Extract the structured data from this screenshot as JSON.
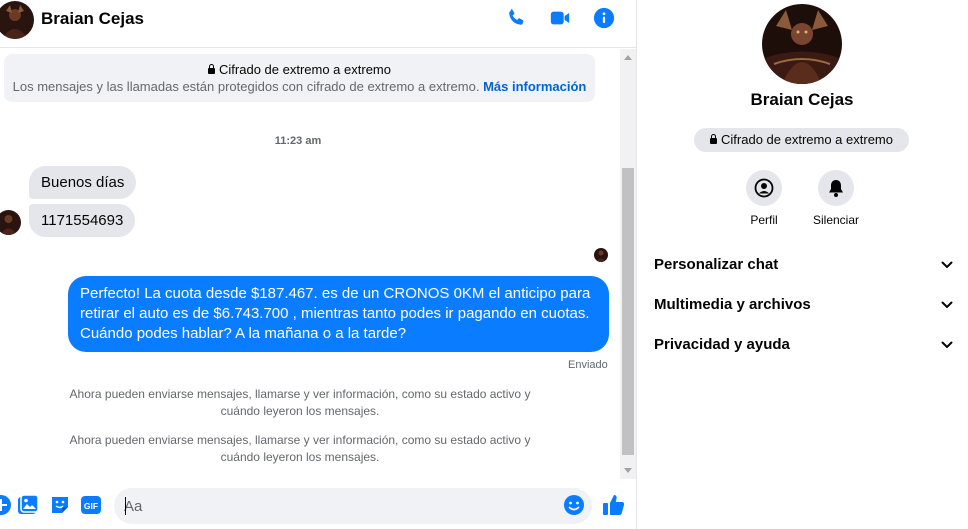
{
  "header": {
    "contact_name": "Braian Cejas",
    "icons": [
      "phone-icon",
      "video-camera-icon",
      "info-icon"
    ],
    "accent_color": "#0a7cff"
  },
  "thread": {
    "e2e_notice": {
      "title": "Cifrado de extremo a extremo",
      "description": "Los mensajes y las llamadas están protegidos con cifrado de extremo a extremo.",
      "link": "Más información"
    },
    "timestamp": "11:23 am",
    "incoming": [
      "Buenos días",
      "1171554693"
    ],
    "outgoing": "Perfecto! La cuota desde $187.467. es de un CRONOS 0KM el anticipo para retirar el auto es de $6.743.700 , mientras tanto podes ir pagando en cuotas. Cuándo podes hablar? A la mañana o a la tarde?",
    "sent_status": "Enviado",
    "system_messages": [
      "Ahora pueden enviarse mensajes, llamarse y ver información, como su estado activo y cuándo leyeron los mensajes.",
      "Ahora pueden enviarse mensajes, llamarse y ver información, como su estado activo y cuándo leyeron los mensajes."
    ]
  },
  "composer": {
    "placeholder": "Aa",
    "icons": [
      "plus-circle-icon",
      "image-icon",
      "sticker-icon",
      "gif-icon",
      "emoji-icon",
      "thumbs-up-icon"
    ],
    "gif_label": "GIF"
  },
  "info_panel": {
    "name": "Braian Cejas",
    "e2e_label": "Cifrado de extremo a extremo",
    "actions": [
      {
        "label": "Perfil",
        "icon": "profile-icon"
      },
      {
        "label": "Silenciar",
        "icon": "bell-icon"
      }
    ],
    "sections": [
      {
        "label": "Personalizar chat"
      },
      {
        "label": "Multimedia y archivos"
      },
      {
        "label": "Privacidad y ayuda"
      }
    ]
  }
}
